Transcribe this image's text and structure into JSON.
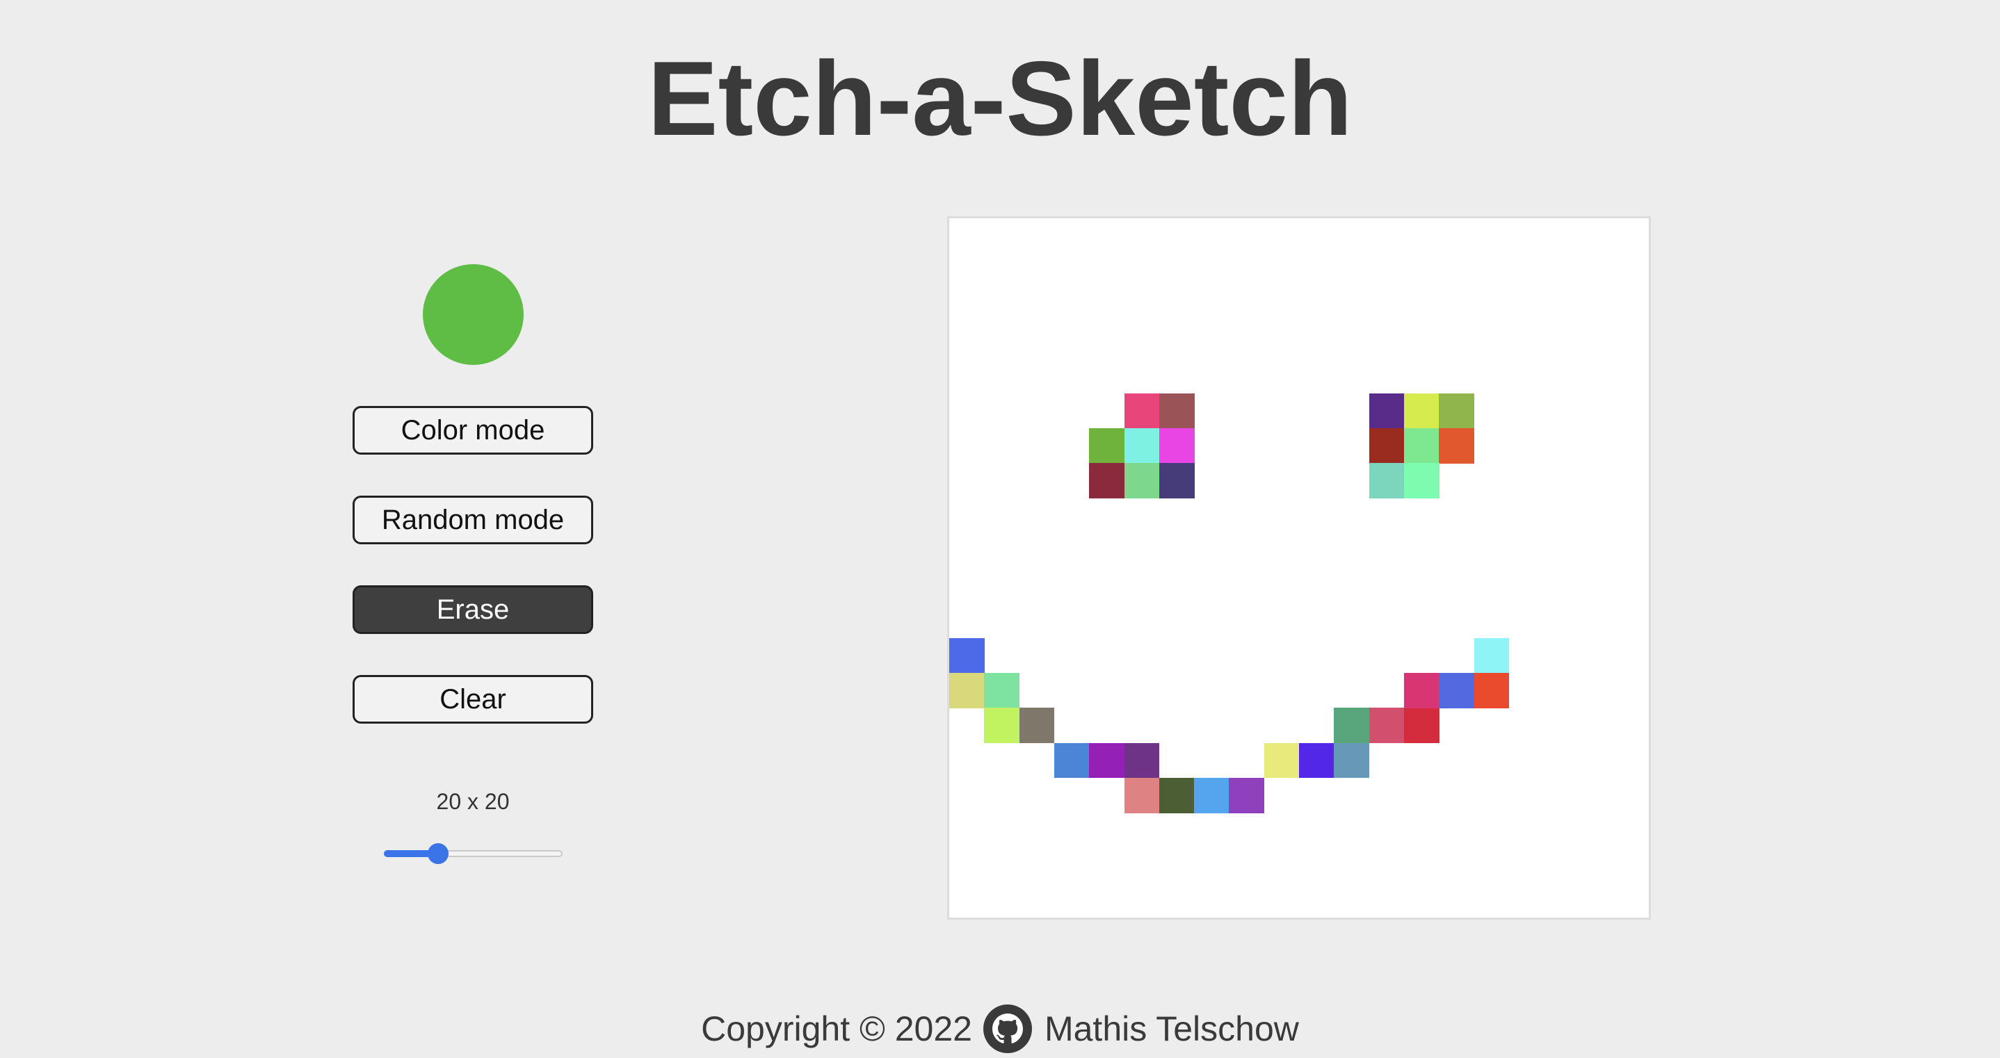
{
  "header": {
    "title": "Etch-a-Sketch"
  },
  "controls": {
    "current_color": "#5fbd45",
    "buttons": [
      {
        "label": "Color mode",
        "name": "color-mode-button",
        "active": false
      },
      {
        "label": "Random mode",
        "name": "random-mode-button",
        "active": false
      },
      {
        "label": "Erase",
        "name": "erase-button",
        "active": true
      },
      {
        "label": "Clear",
        "name": "clear-button",
        "active": false
      }
    ],
    "grid_size_label": "20 x 20",
    "grid_size": {
      "value": 20,
      "min": 1,
      "max": 64
    }
  },
  "board": {
    "rows": 20,
    "cols": 20,
    "background": "#ffffff",
    "cells": [
      {
        "row": 5,
        "col": 5,
        "color": "#e8457a"
      },
      {
        "row": 5,
        "col": 6,
        "color": "#9a5356"
      },
      {
        "row": 6,
        "col": 4,
        "color": "#70b33c"
      },
      {
        "row": 6,
        "col": 5,
        "color": "#7ef1e2"
      },
      {
        "row": 6,
        "col": 6,
        "color": "#e845e4"
      },
      {
        "row": 7,
        "col": 4,
        "color": "#8b2a3c"
      },
      {
        "row": 7,
        "col": 5,
        "color": "#7dd88d"
      },
      {
        "row": 7,
        "col": 6,
        "color": "#463c79"
      },
      {
        "row": 5,
        "col": 12,
        "color": "#592c89"
      },
      {
        "row": 5,
        "col": 13,
        "color": "#d6ec4e"
      },
      {
        "row": 5,
        "col": 14,
        "color": "#90b54c"
      },
      {
        "row": 6,
        "col": 12,
        "color": "#9a2b1f"
      },
      {
        "row": 6,
        "col": 13,
        "color": "#7de88f"
      },
      {
        "row": 6,
        "col": 14,
        "color": "#e1582e"
      },
      {
        "row": 7,
        "col": 12,
        "color": "#7bd6bd"
      },
      {
        "row": 7,
        "col": 13,
        "color": "#7dfcb0"
      },
      {
        "row": 12,
        "col": 0,
        "color": "#4d6ae8"
      },
      {
        "row": 13,
        "col": 0,
        "color": "#d9d87a"
      },
      {
        "row": 13,
        "col": 1,
        "color": "#7ee3a0"
      },
      {
        "row": 14,
        "col": 1,
        "color": "#c1f25f"
      },
      {
        "row": 14,
        "col": 2,
        "color": "#80776b"
      },
      {
        "row": 15,
        "col": 3,
        "color": "#4c84d6"
      },
      {
        "row": 15,
        "col": 4,
        "color": "#9420b8"
      },
      {
        "row": 15,
        "col": 5,
        "color": "#6e3386"
      },
      {
        "row": 16,
        "col": 5,
        "color": "#df8283"
      },
      {
        "row": 16,
        "col": 6,
        "color": "#4b5e34"
      },
      {
        "row": 16,
        "col": 7,
        "color": "#55a4ee"
      },
      {
        "row": 16,
        "col": 8,
        "color": "#8f40bc"
      },
      {
        "row": 15,
        "col": 9,
        "color": "#e9ea7c"
      },
      {
        "row": 15,
        "col": 10,
        "color": "#5327e8"
      },
      {
        "row": 15,
        "col": 11,
        "color": "#6898b8"
      },
      {
        "row": 14,
        "col": 11,
        "color": "#5aa67c"
      },
      {
        "row": 14,
        "col": 12,
        "color": "#d2506e"
      },
      {
        "row": 14,
        "col": 13,
        "color": "#d42c3d"
      },
      {
        "row": 13,
        "col": 13,
        "color": "#d83574"
      },
      {
        "row": 13,
        "col": 14,
        "color": "#5269df"
      },
      {
        "row": 13,
        "col": 15,
        "color": "#ea4b2c"
      },
      {
        "row": 12,
        "col": 15,
        "color": "#90f4f6"
      }
    ]
  },
  "footer": {
    "copyright": "Copyright © 2022",
    "github_icon": "github-icon",
    "author": "Mathis Telschow"
  }
}
